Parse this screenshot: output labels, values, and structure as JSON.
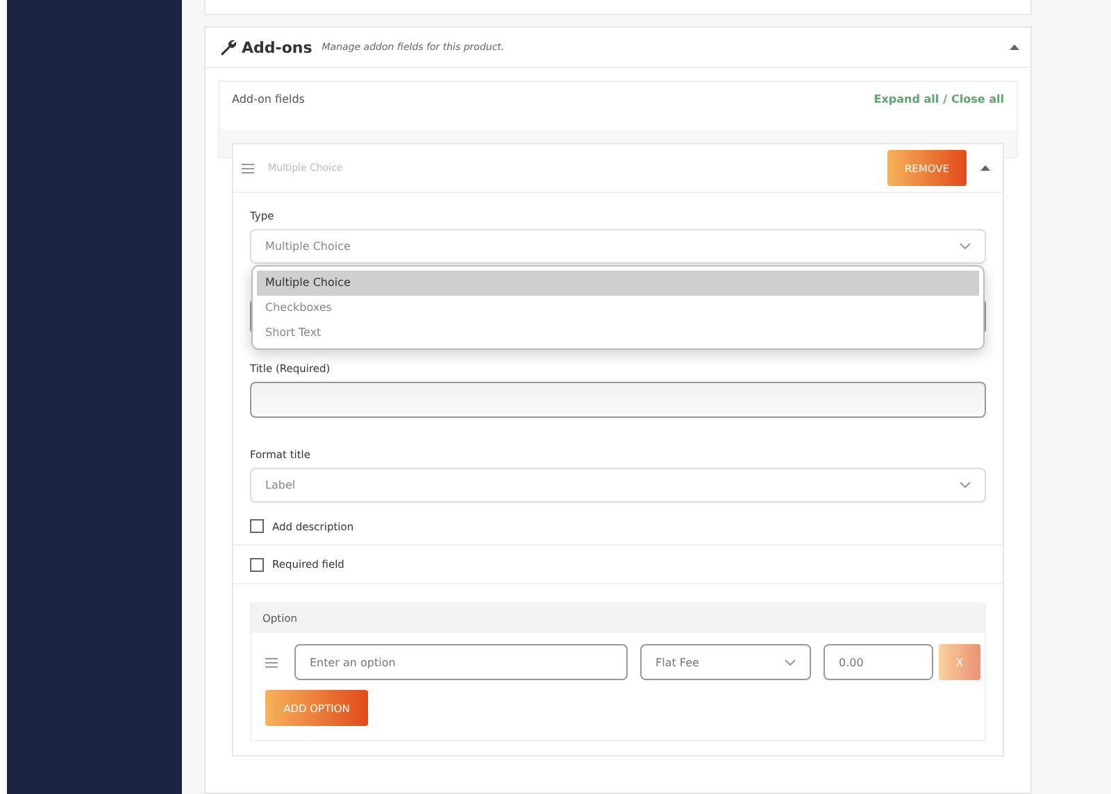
{
  "addons": {
    "title": "Add-ons",
    "subtitle": "Manage addon fields for this product.",
    "expanded": true,
    "fields_heading": "Add-on fields",
    "expand_all": "Expand all",
    "separator": "/",
    "close_all": "Close all",
    "field": {
      "name": "Multiple Choice",
      "remove": "REMOVE",
      "expanded": true,
      "type": {
        "label": "Type",
        "value": "Multiple Choice",
        "options": [
          {
            "label": "Multiple Choice",
            "selected": true
          },
          {
            "label": "Checkboxes",
            "selected": false
          },
          {
            "label": "Short Text",
            "selected": false
          }
        ]
      },
      "title": {
        "label": "Title (Required)"
      },
      "format": {
        "label": "Format title",
        "value": "Label"
      },
      "add_description": {
        "label": "Add description",
        "checked": false
      },
      "required": {
        "label": "Required field",
        "checked": false
      },
      "options": {
        "heading": "Option",
        "rows": [
          {
            "placeholder": "Enter an option",
            "price_type": "Flat Fee",
            "price": "0.00",
            "remove": "X"
          }
        ],
        "add": "ADD OPTION"
      }
    }
  }
}
